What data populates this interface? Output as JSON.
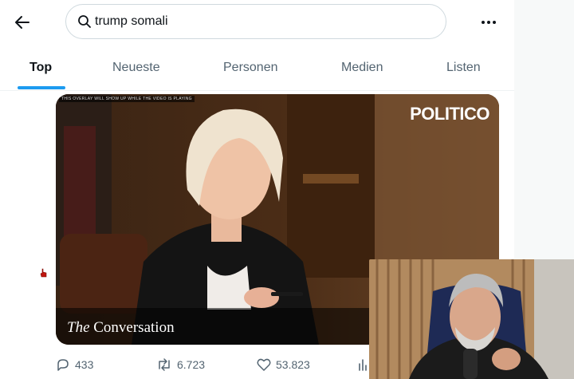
{
  "search": {
    "query": "trump somali"
  },
  "tabs": [
    "Top",
    "Neueste",
    "Personen",
    "Medien",
    "Listen"
  ],
  "media": {
    "overlay_notice": "THIS OVERLAY WILL SHOW UP WHILE THE VIDEO IS PLAYING",
    "brand": "POLITICO",
    "caption_the": "The",
    "caption_rest": "Conversation"
  },
  "actions": {
    "replies": "433",
    "reposts": "6.723",
    "likes": "53.823"
  },
  "colors": {
    "accent": "#1d9bf0",
    "text": "#0f1419",
    "muted": "#536471"
  }
}
